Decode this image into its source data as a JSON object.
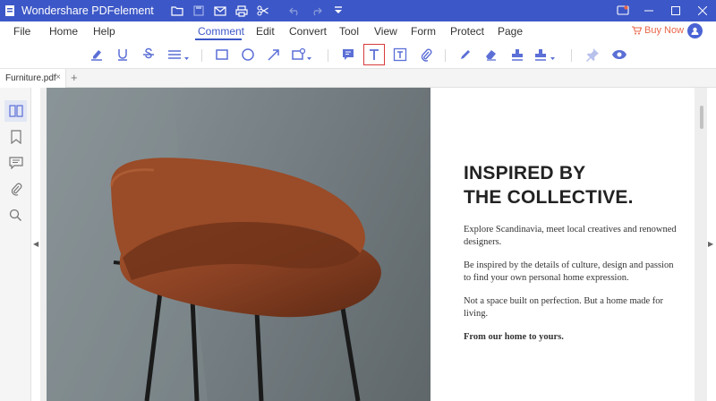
{
  "app": {
    "title": "Wondershare PDFelement",
    "colors": {
      "titlebar": "#3c57c7",
      "accent": "#3c57c7",
      "buy_now": "#e8664a",
      "selected_tool_border": "#d83b3b"
    }
  },
  "quick_access": [
    "folder-icon",
    "save-icon",
    "mail-icon",
    "print-icon",
    "scissors-icon",
    "undo-icon",
    "redo-icon",
    "dropdown-icon"
  ],
  "window_controls": [
    "account-icon",
    "minimize-icon",
    "maximize-icon",
    "close-icon"
  ],
  "menu": {
    "items": [
      "File",
      "Home",
      "Help",
      "Comment",
      "Edit",
      "Convert",
      "Tool",
      "View",
      "Form",
      "Protect",
      "Page"
    ],
    "active": "Comment",
    "buy_now": "Buy Now"
  },
  "toolbar": {
    "tools": [
      "highlight-icon",
      "underline-icon",
      "strikethrough-icon",
      "text-lines-icon",
      "rectangle-icon",
      "oval-icon",
      "arrow-icon",
      "shape-dropdown-icon",
      "sticky-note-icon",
      "text-box-icon",
      "text-field-icon",
      "attachment-icon",
      "pencil-icon",
      "eraser-icon",
      "stamp-icon",
      "signature-stamp-icon",
      "pin-icon",
      "eye-icon"
    ],
    "selected": "text-box-icon"
  },
  "tabs": {
    "open": [
      {
        "name": "Furniture.pdf"
      }
    ],
    "close_symbol": "×",
    "add_symbol": "+"
  },
  "sidebar": {
    "items": [
      "thumbnails-icon",
      "bookmark-icon",
      "comments-icon",
      "attachments-icon",
      "search-icon"
    ],
    "active": "thumbnails-icon"
  },
  "document": {
    "headline_line1": "INSPIRED BY",
    "headline_line2": "THE COLLECTIVE.",
    "paragraphs": [
      "Explore Scandinavia, meet local creatives and renowned designers.",
      "Be inspired by the details of culture, design and passion to find your own personal home expression.",
      "Not a space built on perfection. But a home made for living.",
      "From our home to yours."
    ]
  }
}
